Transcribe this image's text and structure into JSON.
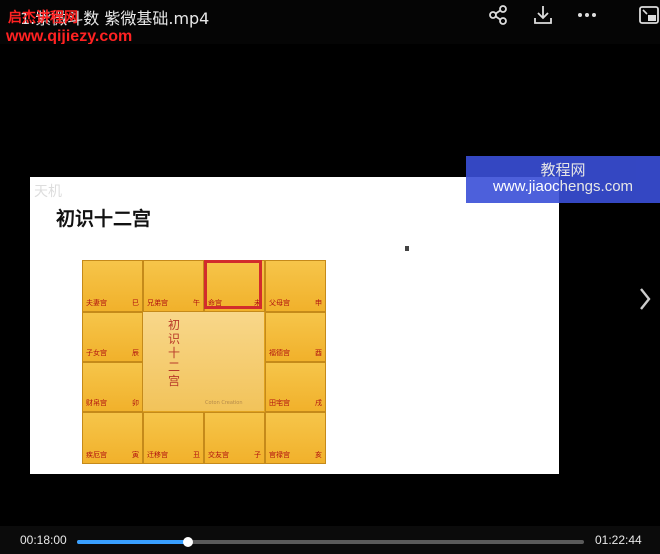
{
  "header": {
    "title": "1.紫微斗数 紫微基础.mp4",
    "watermark_red": "启杰讲程网",
    "watermark_url": "www.qijiezy.com",
    "icons": [
      "share-icon",
      "download-icon",
      "more-icon",
      "picture-in-picture-icon"
    ]
  },
  "slide": {
    "title": "初识十二宫",
    "brand_ghost": "天机",
    "center_text": "初识十二宫",
    "center_credit": "Coton Creation",
    "palaces": [
      {
        "name": "夫妻宫",
        "branch": "巳"
      },
      {
        "name": "兄弟宫",
        "branch": "午"
      },
      {
        "name": "命宫",
        "branch": "未"
      },
      {
        "name": "父母宫",
        "branch": "申"
      },
      {
        "name": "子女宫",
        "branch": "辰"
      },
      {
        "name": "福德宫",
        "branch": "酉"
      },
      {
        "name": "财帛宫",
        "branch": "卯"
      },
      {
        "name": "田宅宫",
        "branch": "戌"
      },
      {
        "name": "疾厄宫",
        "branch": "寅"
      },
      {
        "name": "迁移宫",
        "branch": "丑"
      },
      {
        "name": "交友宫",
        "branch": "子"
      },
      {
        "name": "官禄宫",
        "branch": "亥"
      }
    ]
  },
  "overlay_watermark": {
    "line1": "教程网",
    "line2": "www.jiaochengs.com"
  },
  "player": {
    "current_time": "00:18:00",
    "duration": "01:22:44",
    "progress": 0.218,
    "accent_color": "#3aa0ff"
  }
}
